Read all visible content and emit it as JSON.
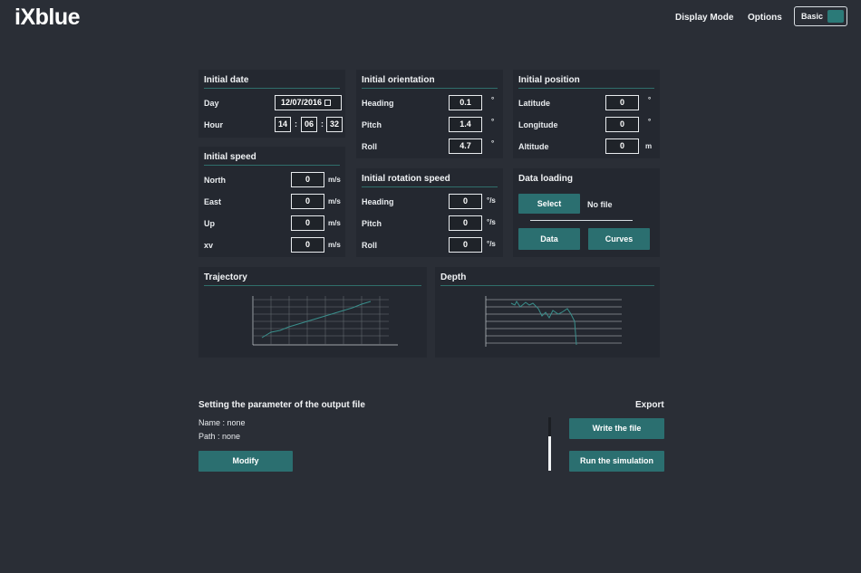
{
  "header": {
    "logo": "iXblue",
    "display_mode": "Display Mode",
    "options": "Options",
    "mode_button": "Basic",
    "accent": "#2b7a78"
  },
  "initial_date": {
    "title": "Initial date",
    "day_label": "Day",
    "day_value": "12/07/2016",
    "hour_label": "Hour",
    "hour": "14",
    "minute": "06",
    "second": "32",
    "sep": ":"
  },
  "initial_orientation": {
    "title": "Initial orientation",
    "rows": [
      {
        "label": "Heading",
        "value": "0.1",
        "unit": "°"
      },
      {
        "label": "Pitch",
        "value": "1.4",
        "unit": "°"
      },
      {
        "label": "Roll",
        "value": "4.7",
        "unit": "°"
      }
    ]
  },
  "initial_position": {
    "title": "Initial position",
    "rows": [
      {
        "label": "Latitude",
        "value": "0",
        "unit": "°"
      },
      {
        "label": "Longitude",
        "value": "0",
        "unit": "°"
      },
      {
        "label": "Altitude",
        "value": "0",
        "unit": "m"
      }
    ]
  },
  "initial_speed": {
    "title": "Initial speed",
    "rows": [
      {
        "label": "North",
        "value": "0",
        "unit": "m/s"
      },
      {
        "label": "East",
        "value": "0",
        "unit": "m/s"
      },
      {
        "label": "Up",
        "value": "0",
        "unit": "m/s"
      },
      {
        "label": "xv",
        "value": "0",
        "unit": "m/s"
      }
    ]
  },
  "initial_rotation_speed": {
    "title": "Initial rotation speed",
    "rows": [
      {
        "label": "Heading",
        "value": "0",
        "unit": "°/s"
      },
      {
        "label": "Pitch",
        "value": "0",
        "unit": "°/s"
      },
      {
        "label": "Roll",
        "value": "0",
        "unit": "°/s"
      }
    ]
  },
  "data_loading": {
    "title": "Data loading",
    "select_button": "Select",
    "file_status": "No file",
    "data_button": "Data",
    "curves_button": "Curves"
  },
  "trajectory": {
    "title": "Trajectory"
  },
  "depth": {
    "title": "Depth"
  },
  "output": {
    "title": "Setting the parameter of the output file",
    "name_line": "Name : none",
    "path_line": "Path : none",
    "modify_button": "Modify"
  },
  "export": {
    "title": "Export",
    "write_button": "Write the file",
    "run_button": "Run the simulation"
  }
}
